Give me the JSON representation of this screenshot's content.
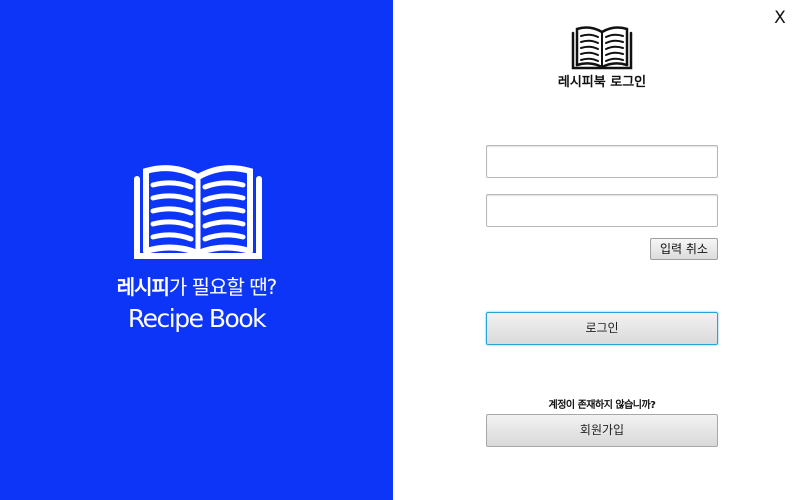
{
  "brand_panel": {
    "tagline_bold": "레시피",
    "tagline_rest": "가 필요할 땐?",
    "brand_name": "Recipe Book",
    "background_color": "#0d35f7",
    "icon": "open-book-icon"
  },
  "window": {
    "close_label": "X"
  },
  "login_form": {
    "icon": "open-book-icon",
    "title": "레시피북 로그인",
    "id_field": {
      "value": "",
      "placeholder": ""
    },
    "password_field": {
      "value": "",
      "placeholder": ""
    },
    "clear_label": "입력 취소",
    "login_label": "로그인",
    "signup_prompt": "계정이 존재하지 않습니까?",
    "signup_label": "회원가입",
    "focus_color": "#2aa3d8"
  }
}
